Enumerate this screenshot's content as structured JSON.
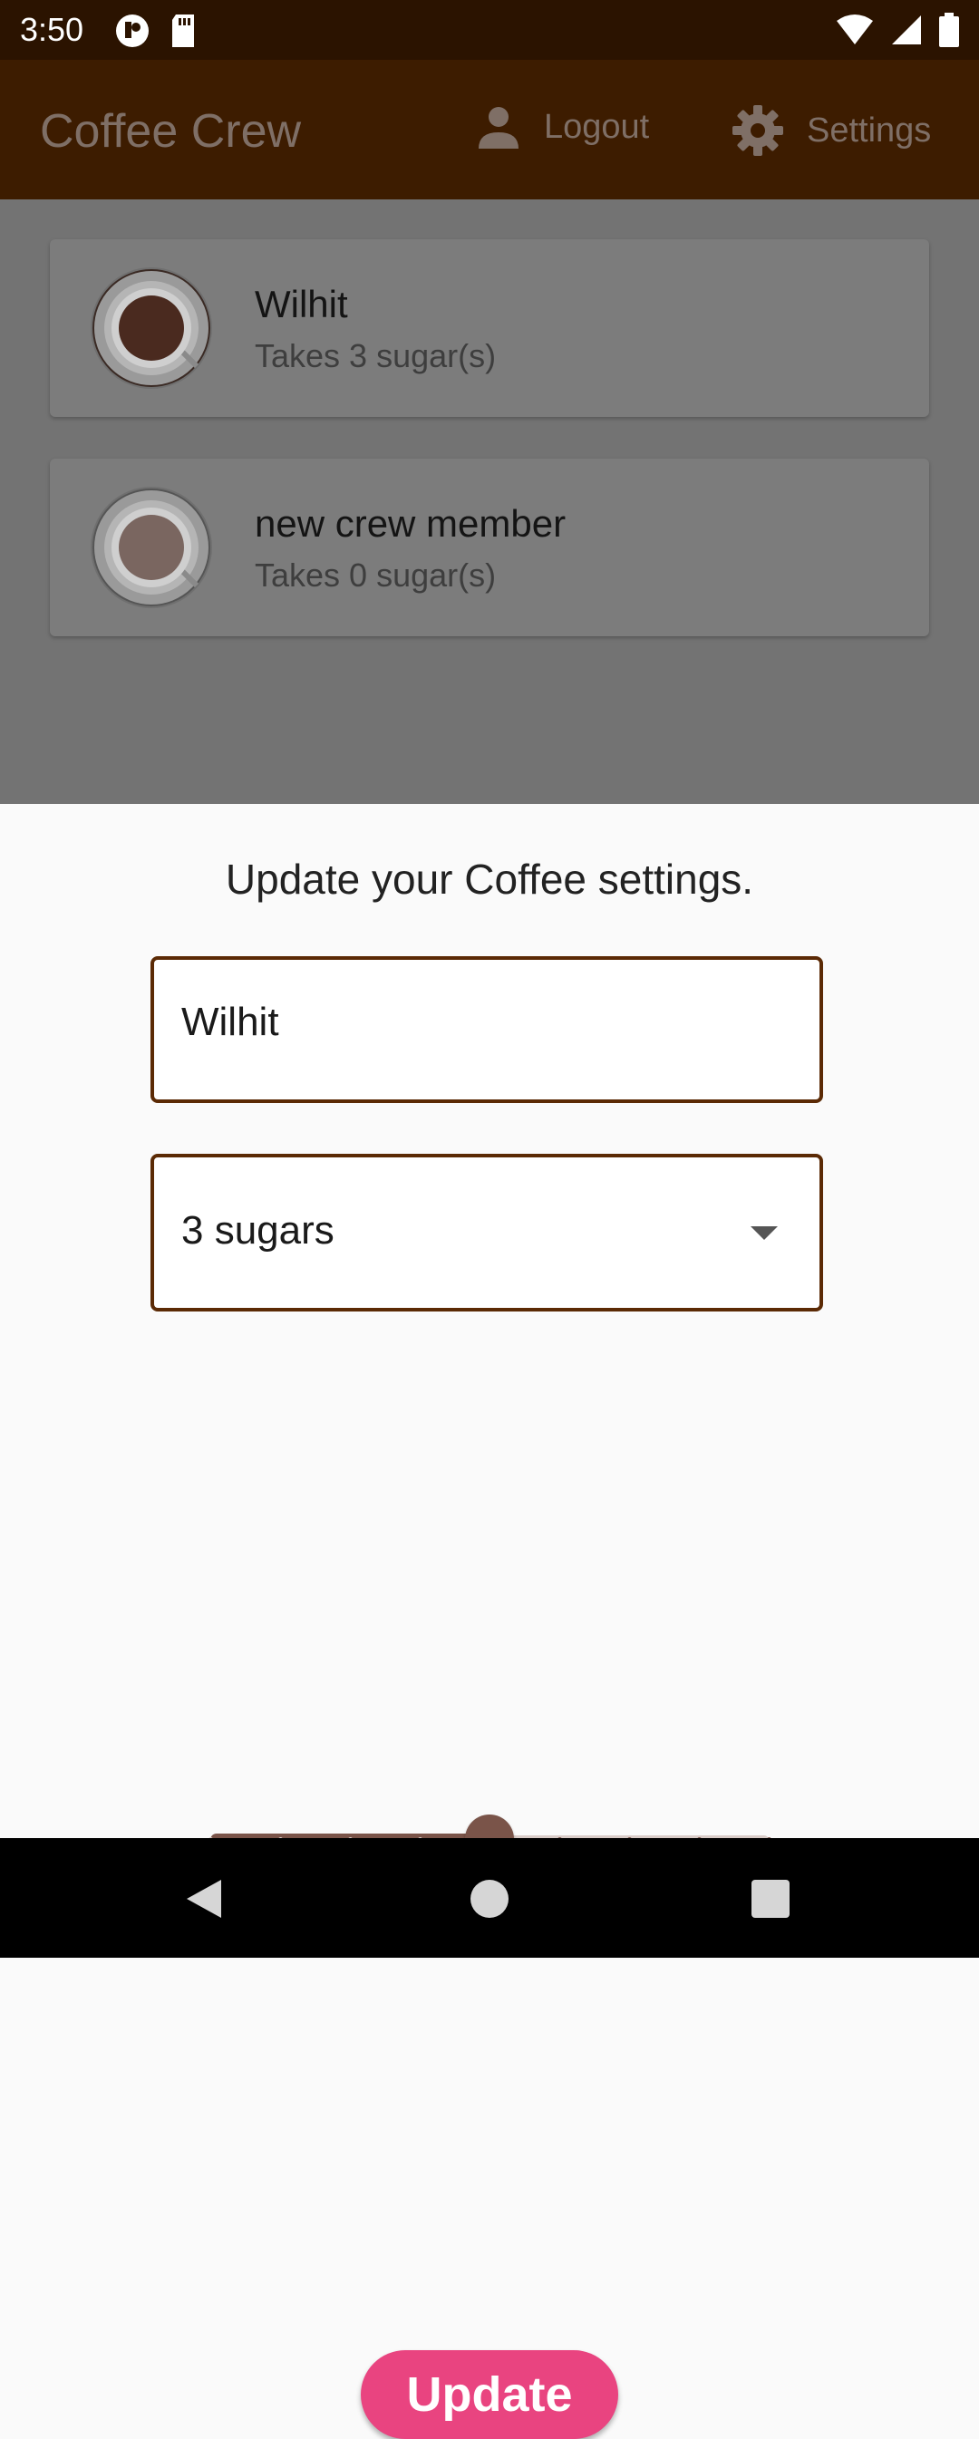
{
  "status_bar": {
    "time": "3:50",
    "left_icons": [
      "pocket-icon",
      "sd-card-icon"
    ],
    "right_icons": [
      "wifi-icon",
      "signal-icon",
      "battery-icon"
    ]
  },
  "app_bar": {
    "title": "Coffee Crew",
    "logout_label": "Logout",
    "settings_label": "Settings",
    "colors": {
      "background": "#3D1C00",
      "text": "#7F6F66"
    }
  },
  "crew_list": [
    {
      "name": "Wilhit",
      "subtitle": "Takes 3 sugar(s)",
      "icon": "coffee-cup-icon",
      "coffee_color": "#4A2A1F"
    },
    {
      "name": "new crew member",
      "subtitle": "Takes 0 sugar(s)",
      "icon": "coffee-cup-icon",
      "coffee_color": "#7A6660"
    }
  ],
  "settings_sheet": {
    "heading": "Update your Coffee settings.",
    "name_value": "Wilhit",
    "sugar_selected": "3 sugars",
    "strength_slider": {
      "min": 100,
      "max": 900,
      "value": 500,
      "divisions": 8
    },
    "update_label": "Update",
    "colors": {
      "border": "#5B2A05",
      "slider": "#7A5449",
      "button": "#E94480"
    }
  },
  "nav_bar": {
    "icons": [
      "back-icon",
      "home-icon",
      "recents-icon"
    ]
  }
}
